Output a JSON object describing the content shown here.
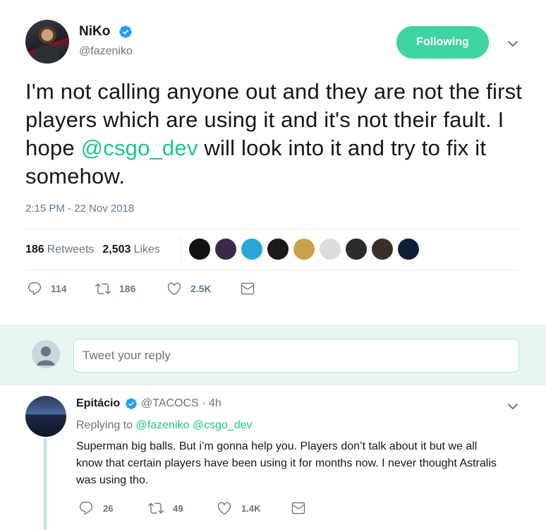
{
  "tweet": {
    "display_name": "NiKo",
    "handle": "@fazeniko",
    "follow_label": "Following",
    "text_before": "I'm not calling anyone out and they are not the first players which are using it and it's not their fault. I hope ",
    "mention": "@csgo_dev",
    "text_after": " will look into it and try to fix it somehow.",
    "timestamp": "2:15 PM - 22 Nov 2018",
    "retweets_count": "186",
    "retweets_label": "Retweets",
    "likes_count": "2,503",
    "likes_label": "Likes",
    "likers": [
      {
        "name": "liker-1",
        "color": "#111111"
      },
      {
        "name": "liker-2",
        "color": "#3a2a4a"
      },
      {
        "name": "liker-3",
        "color": "#2aa7d8"
      },
      {
        "name": "liker-4",
        "color": "#1a1a1a"
      },
      {
        "name": "liker-5",
        "color": "#c8a24a"
      },
      {
        "name": "liker-6",
        "color": "#dddddd"
      },
      {
        "name": "liker-7",
        "color": "#2b2b2b"
      },
      {
        "name": "liker-8",
        "color": "#3a2f28"
      },
      {
        "name": "liker-9",
        "color": "#0e1e3a"
      }
    ],
    "actions": {
      "replies": "114",
      "retweets": "186",
      "likes": "2.5K"
    }
  },
  "reply_box": {
    "placeholder": "Tweet your reply"
  },
  "reply": {
    "display_name": "Epitácio",
    "handle_time": "@TACOCS · 4h",
    "replying_prefix": "Replying to",
    "replying_to_1": "@fazeniko",
    "replying_to_2": "@csgo_dev",
    "text": "Superman big balls. But i’m gonna help you. Players don’t talk about it but we all know that certain players have been using it for months now. I never thought Astralis was using tho.",
    "actions": {
      "replies": "26",
      "retweets": "49",
      "likes": "1.4K"
    }
  },
  "colors": {
    "accent": "#3fd3a0",
    "mention": "#1fc48e",
    "verified": "#1da1f2",
    "muted": "#657786"
  },
  "icons": [
    "verified-icon",
    "chevron-down-icon",
    "reply-icon",
    "retweet-icon",
    "like-icon",
    "message-icon"
  ]
}
